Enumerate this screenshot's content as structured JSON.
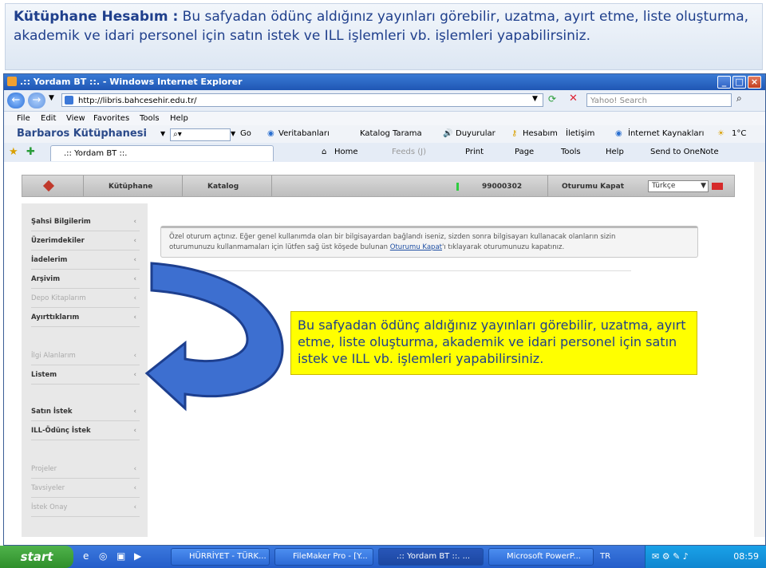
{
  "heading": {
    "bold": "Kütüphane Hesabım :",
    "text": " Bu safyadan ödünç aldığınız yayınları görebilir, uzatma, ayırt etme, liste oluşturma, akademik ve idari personel için satın istek ve ILL işlemleri vb. işlemleri yapabilirsiniz."
  },
  "window": {
    "title": ".:: Yordam BT ::. - Windows Internet Explorer",
    "address": "http://libris.bahcesehir.edu.tr/",
    "search_placeholder": "Yahoo! Search",
    "menu": [
      "File",
      "Edit",
      "View",
      "Favorites",
      "Tools",
      "Help"
    ],
    "toolbar_links": {
      "brand": "Barbaros Kütüphanesi",
      "go": "Go",
      "veritabanlari": "Veritabanları",
      "katalog": "Katalog Tarama",
      "duyurular": "Duyurular",
      "hesabim": "Hesabım",
      "iletisim": "İletişim",
      "internet": "İnternet Kaynakları",
      "weather": "1°C"
    },
    "tab_title": ".:: Yordam BT ::.",
    "cmdbar": {
      "home": "Home",
      "feeds": "Feeds (J)",
      "print": "Print",
      "page": "Page",
      "tools": "Tools",
      "help": "Help",
      "onenote": "Send to OneNote"
    }
  },
  "page": {
    "nav": {
      "kutuphane": "Kütüphane",
      "katalog": "Katalog",
      "user_id": "99000302",
      "logout": "Oturumu Kapat",
      "language": "Türkçe"
    },
    "sidebar": [
      {
        "label": "Şahsi Bilgilerim",
        "dim": false
      },
      {
        "label": "Üzerimdekiler",
        "dim": false
      },
      {
        "label": "İadelerim",
        "dim": false
      },
      {
        "label": "Arşivim",
        "dim": false
      },
      {
        "label": "Depo Kitaplarım",
        "dim": true
      },
      {
        "label": "Ayırttıklarım",
        "dim": false
      },
      {
        "label": "İlgi Alanlarım",
        "dim": true
      },
      {
        "label": "Listem",
        "dim": false
      },
      {
        "label": "Satın İstek",
        "dim": false
      },
      {
        "label": "ILL-Ödünç İstek",
        "dim": false
      },
      {
        "label": "Projeler",
        "dim": true
      },
      {
        "label": "Tavsiyeler",
        "dim": true
      },
      {
        "label": "İstek Onay",
        "dim": true
      }
    ],
    "notice": {
      "line1": "Özel oturum açtınız. Eğer genel kullanımda olan bir bilgisayardan bağlandı iseniz, sizden sonra bilgisayarı kullanacak olanların sizin",
      "line2_pre": "oturumunuzu kullanmamaları için lütfen sağ üst köşede bulunan ",
      "line2_link": "Oturumu Kapat",
      "line2_post": "'ı tıklayarak oturumunuzu kapatınız."
    },
    "callout": "Bu safyadan ödünç aldığınız yayınları görebilir, uzatma, ayırt etme, liste oluşturma, akademik ve idari personel için satın istek ve ILL vb. işlemleri yapabilirsiniz."
  },
  "taskbar": {
    "start": "start",
    "tasks": [
      "HÜRRİYET - TÜRK...",
      "FileMaker Pro - [Y...",
      ".:: Yordam BT ::. ...",
      "Microsoft PowerP..."
    ],
    "lang": "TR",
    "clock": "08:59"
  },
  "colors": {
    "heading_text": "#1f3f8c",
    "callout_bg": "#ffff00",
    "arrow": "#3d6fd0"
  }
}
